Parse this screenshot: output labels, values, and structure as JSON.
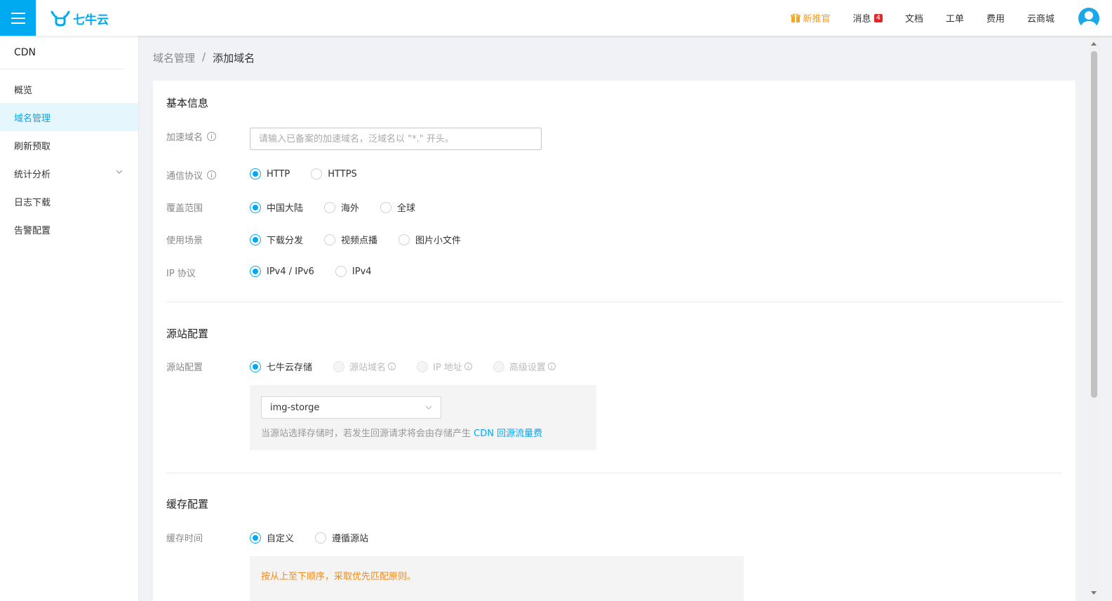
{
  "header": {
    "logo_text": "七牛云",
    "nav": [
      {
        "label": "新推官",
        "icon": "gift-icon",
        "highlight": true
      },
      {
        "label": "消息",
        "badge": "4"
      },
      {
        "label": "文档"
      },
      {
        "label": "工单"
      },
      {
        "label": "费用"
      },
      {
        "label": "云商城"
      }
    ]
  },
  "sidebar": {
    "title": "CDN",
    "items": [
      {
        "label": "概览"
      },
      {
        "label": "域名管理",
        "active": true
      },
      {
        "label": "刷新预取"
      },
      {
        "label": "统计分析",
        "expandable": true
      },
      {
        "label": "日志下载"
      },
      {
        "label": "告警配置"
      }
    ]
  },
  "breadcrumb": {
    "parent": "域名管理",
    "separator": "/",
    "current": "添加域名"
  },
  "basic": {
    "title": "基本信息",
    "domain": {
      "label": "加速域名",
      "placeholder": "请输入已备案的加速域名，泛域名以 \"*.\" 开头。",
      "value": ""
    },
    "protocol": {
      "label": "通信协议",
      "options": [
        "HTTP",
        "HTTPS"
      ],
      "selected": "HTTP"
    },
    "coverage": {
      "label": "覆盖范围",
      "options": [
        "中国大陆",
        "海外",
        "全球"
      ],
      "selected": "中国大陆"
    },
    "scenario": {
      "label": "使用场景",
      "options": [
        "下载分发",
        "视频点播",
        "图片小文件"
      ],
      "selected": "下载分发"
    },
    "ip": {
      "label": "IP 协议",
      "options": [
        "IPv4 / IPv6",
        "IPv4"
      ],
      "selected": "IPv4 / IPv6"
    }
  },
  "origin": {
    "title": "源站配置",
    "label": "源站配置",
    "options": [
      "七牛云存储",
      "源站域名",
      "IP 地址",
      "高级设置"
    ],
    "selected": "七牛云存储",
    "bucket": "img-storge",
    "note_prefix": "当源站选择存储时，若发生回源请求将会由存储产生",
    "note_link": "CDN 回源流量费"
  },
  "cache": {
    "title": "缓存配置",
    "label": "缓存时间",
    "options": [
      "自定义",
      "遵循源站"
    ],
    "selected": "自定义",
    "note": "按从上至下顺序，采取优先匹配原则。"
  },
  "colors": {
    "accent": "#00aaf0",
    "warning": "#f08a1c",
    "badge": "#e02828"
  }
}
